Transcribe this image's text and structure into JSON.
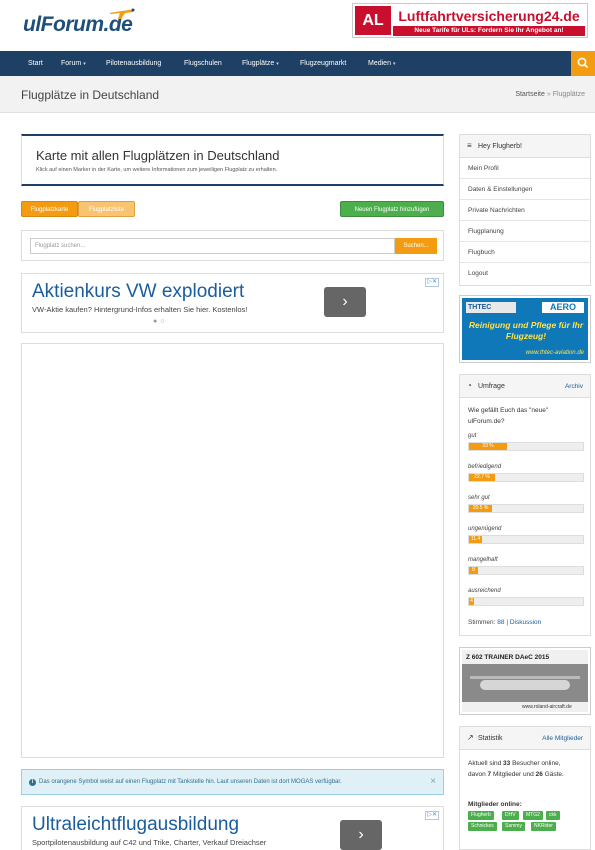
{
  "header": {
    "logo_text": "ulForum.de",
    "banner": {
      "logo": "AL",
      "title": "Luftfahrtversicherung24.de",
      "subtitle": "Neue Tarife für ULs: Fordern Sie Ihr Angebot an!"
    }
  },
  "nav": {
    "items": [
      {
        "label": "Start",
        "has_caret": false
      },
      {
        "label": "Forum",
        "has_caret": true
      },
      {
        "label": "Pilotenausbildung",
        "has_caret": false
      },
      {
        "label": "Flugschulen",
        "has_caret": false
      },
      {
        "label": "Flugplätze",
        "has_caret": true
      },
      {
        "label": "Flugzeugmarkt",
        "has_caret": false
      },
      {
        "label": "Medien",
        "has_caret": true
      }
    ],
    "search_icon": "search-icon"
  },
  "titlebar": {
    "title": "Flugplätze in Deutschland",
    "breadcrumb": {
      "home": "Startseite",
      "separator": "»",
      "current": "Flugplätze"
    }
  },
  "intro": {
    "title": "Karte mit allen Flugplätzen in Deutschland",
    "subtitle": "Klick auf einen Marker in der Karte, um weitere Informationen zum jeweiligen Flugplatz zu erhalten."
  },
  "buttons": {
    "karte": "Flugplatzkarte",
    "liste": "Flugplatzliste",
    "add": "Neuen Flugplatz hinzufügen"
  },
  "search": {
    "placeholder": "Flugplatz suchen...",
    "button": "Suchen..."
  },
  "ad1": {
    "title": "Aktienkurs VW explodiert",
    "text": "VW-Aktie kaufen? Hintergrund-Infos erhalten Sie hier. Kostenlos!",
    "arrow": "›",
    "info": "▷✕",
    "dots": "●○"
  },
  "alert": {
    "text": "Das orangene Symbol weist auf einen Flugplatz mit Tankstelle hin. Laut unseren Daten ist dort MOGAS verfügbar.",
    "close": "×"
  },
  "ad2": {
    "title": "Ultraleichtflugausbildung",
    "text": "Sportpilotenausbildung auf C42 und Trike, Charter, Verkauf Dreiachser",
    "arrow": "›",
    "info": "▷✕"
  },
  "sidebar": {
    "user": {
      "greeting": "Hey Flugherb!",
      "icon": "menu-icon",
      "items": [
        "Mein Profil",
        "Daten & Einstellungen",
        "Private Nachrichten",
        "Flugplanung",
        "Flugbuch",
        "Logout"
      ]
    },
    "thtec_ad": {
      "brand": "THTEC",
      "brand2": "AERO",
      "text": "Reinigung und Pflege für Ihr Flugzeug!",
      "url": "www.thtec-aviation.de"
    },
    "poll": {
      "title": "Umfrage",
      "icon": "pie-chart-icon",
      "archive": "Archiv",
      "question": "Wie gefällt Euch das \"neue\" ulForum.de?",
      "options": [
        {
          "label": "gut",
          "percent": 33,
          "text": "33 %"
        },
        {
          "label": "befriedigend",
          "percent": 22.7,
          "text": "22.7 %"
        },
        {
          "label": "sehr gut",
          "percent": 20.5,
          "text": "20.5 %"
        },
        {
          "label": "ungenügend",
          "percent": 11.4,
          "text": "11.4"
        },
        {
          "label": "mangelhaft",
          "percent": 8,
          "text": "8"
        },
        {
          "label": "ausreichend",
          "percent": 4,
          "text": "4"
        }
      ],
      "votes_label": "Stimmen:",
      "votes": "88",
      "divider": "|",
      "discussion": "Diskussion"
    },
    "trainer_ad": {
      "head": "Z 602   TRAINER DAeC 2015",
      "footer": "www.roland-aircraft.de"
    },
    "stats": {
      "title": "Statistik",
      "icon": "line-chart-icon",
      "link": "Alle Mitglieder",
      "line1_pre": "Aktuell sind ",
      "visitors": "33",
      "line1_post": " Besucher online,",
      "line2_pre": "davon ",
      "members_count": "7",
      "line2_mid": " Mitglieder und ",
      "guests": "26",
      "line2_post": " Gäste.",
      "members_label": "Mitglieder online:",
      "members": [
        "Flugherb",
        "DHV",
        "MTG2",
        "ckk",
        "Schnickes",
        "Sammy",
        "NKRider"
      ]
    }
  }
}
